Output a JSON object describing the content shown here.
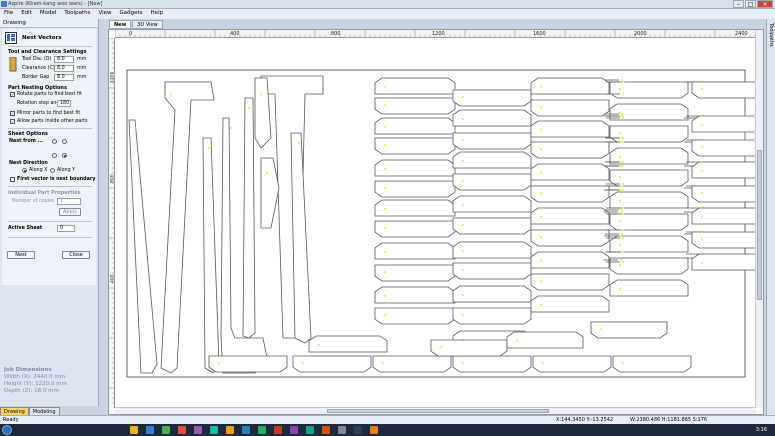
{
  "app": {
    "title": "Aspire (Kham-kang woo wars) - [New]",
    "menu": [
      "File",
      "Edit",
      "Model",
      "Toolpaths",
      "View",
      "Gadgets",
      "Help"
    ]
  },
  "panel": {
    "header": "Drawing",
    "form_title": "Nest Vectors",
    "tool_section": "Tool and Clearance Settings",
    "tool_dia_label": "Tool Dia. (D)",
    "tool_dia_value": "8.0",
    "clearance_label": "Clearance (C)",
    "clearance_value": "8.0",
    "border_gap_label": "Border Gap",
    "border_gap_value": "8.0",
    "unit": "mm",
    "part_nesting_section": "Part Nesting Options",
    "rotate_label": "Rotate parts to find best fit",
    "rotation_step_label": "Rotation step angle",
    "rotation_step_value": "180",
    "mirror_label": "Mirror parts to find best fit",
    "inside_label": "Allow parts inside other parts",
    "sheet_section": "Sheet Options",
    "nest_from_label": "Nest from ...",
    "nest_direction_label": "Nest Direction",
    "along_x": "Along X",
    "along_y": "Along Y",
    "first_vector_label": "First vector is nest boundary",
    "individual_section": "Individual Part Properties",
    "copies_label": "Number of copies",
    "copies_value": "1",
    "apply_label": "Apply",
    "active_sheet_label": "Active Sheet",
    "active_sheet_value": "0",
    "nest_button": "Nest",
    "close_button": "Close"
  },
  "job": {
    "heading": "Job Dimensions",
    "width": "Width  (X): 2440.0 mm",
    "height": "Height (Y): 1220.0 mm",
    "depth": "Depth  (Z): 18.0 mm"
  },
  "bottom_tabs": [
    "Drawing",
    "Modeling"
  ],
  "view_tabs": [
    "New",
    "3D View"
  ],
  "ruler": {
    "h_labels": [
      "0",
      "400",
      "800",
      "1200",
      "1600",
      "2000",
      "2400"
    ],
    "v_labels": [
      "1200",
      "800",
      "400"
    ]
  },
  "right_strip_label": "Toolpaths",
  "status": {
    "left": "Ready",
    "coords": "X:144.3450 Y:-13.2542",
    "dims": "W:2380.486  H:1181.865  S:176"
  },
  "clock": "3:16",
  "colors": {
    "accent": "#ffd36a",
    "part_fill": "#ffffff",
    "part_stroke": "#555555",
    "marker": "#e6f07a"
  }
}
